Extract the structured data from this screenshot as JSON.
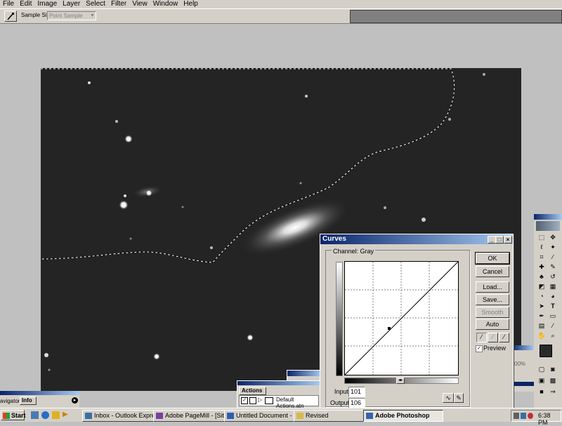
{
  "menu": [
    "File",
    "Edit",
    "Image",
    "Layer",
    "Select",
    "Filter",
    "View",
    "Window",
    "Help"
  ],
  "options": {
    "sample_size_label": "Sample Size:",
    "sample_size_value": "Point Sample"
  },
  "curves": {
    "title": "Curves",
    "channel_label": "Channel:",
    "channel_value": "Gray",
    "buttons": {
      "ok": "OK",
      "cancel": "Cancel",
      "load": "Load...",
      "save": "Save...",
      "smooth": "Smooth",
      "auto": "Auto"
    },
    "preview_label": "Preview",
    "preview_checked": true,
    "input_label": "Input:",
    "input_value": "101",
    "output_label": "Output:",
    "output_value": "106"
  },
  "actions": {
    "tab": "Actions",
    "item": "Default Actions.atn"
  },
  "navigator": {
    "tab1": "avigator",
    "tab2": "Info"
  },
  "misc": {
    "zoom_fragment": "00%"
  },
  "taskbar": {
    "start": "Start",
    "tasks": [
      {
        "label": "Inbox - Outlook Express pr...",
        "icon_color": "#3a6ea5"
      },
      {
        "label": "Adobe PageMill - [Site Det...",
        "icon_color": "#7a3fa0"
      },
      {
        "label": "Untitled Document - Micro...",
        "icon_color": "#2b5fb3"
      },
      {
        "label": "Revised",
        "icon_color": "#d8b84a"
      },
      {
        "label": "Adobe Photoshop",
        "icon_color": "#3366aa",
        "active": true
      }
    ],
    "clock": "6:38 PM"
  }
}
